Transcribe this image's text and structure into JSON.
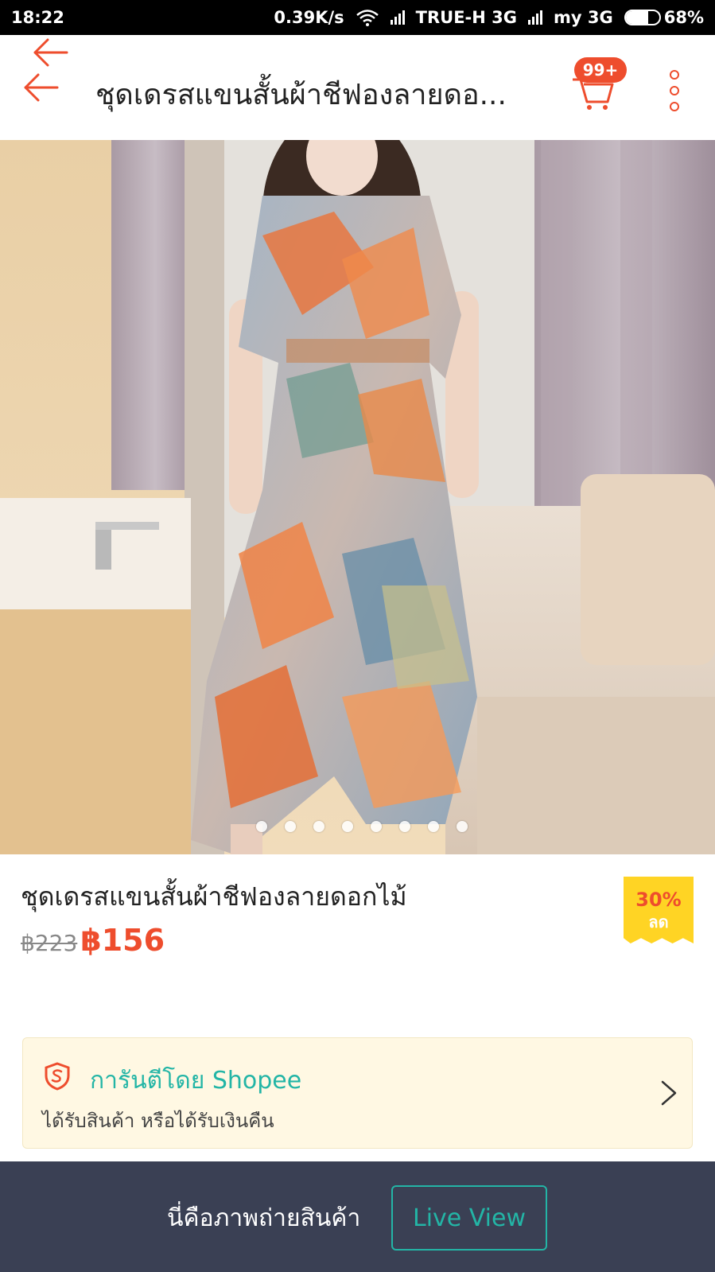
{
  "status_bar": {
    "time": "18:22",
    "net_speed": "0.39K/s",
    "carrier1": "TRUE-H 3G",
    "carrier2": "my 3G",
    "battery": "68%",
    "battery_level": 0.68
  },
  "header": {
    "title": "ชุดเดรสแขนสั้นผ้าชีฟองลายดอ...",
    "cart_badge": "99+",
    "accent_color": "#ee4d2d"
  },
  "gallery": {
    "image_count": 8,
    "current_index": 1
  },
  "product": {
    "name": "ชุดเดรสแขนสั้นผ้าชีฟองลายดอกไม้",
    "old_price": "฿223",
    "price": "฿156",
    "discount_pct": "30%",
    "discount_label": "ลด"
  },
  "guarantee": {
    "title": "การันตีโดย Shopee",
    "subtitle": "ได้รับสินค้า หรือได้รับเงินคืน",
    "color": "#23b5a6"
  },
  "bottom_bar": {
    "text": "นี่คือภาพถ่ายสินค้า",
    "button": "Live View"
  }
}
